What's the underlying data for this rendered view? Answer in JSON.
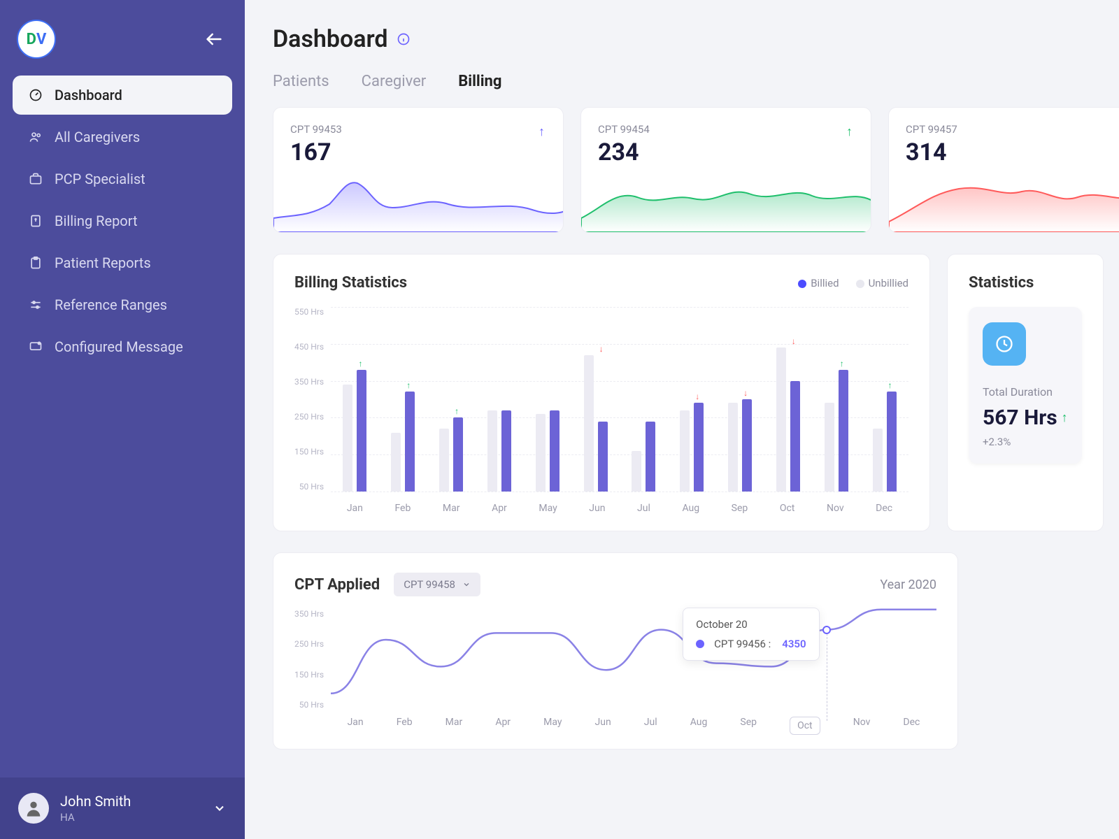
{
  "logo": {
    "d": "D",
    "v": "V"
  },
  "sidebar": {
    "items": [
      {
        "label": "Dashboard",
        "icon": "gauge-icon",
        "active": true
      },
      {
        "label": "All Caregivers",
        "icon": "people-icon"
      },
      {
        "label": "PCP Specialist",
        "icon": "briefcase-icon"
      },
      {
        "label": "Billing Report",
        "icon": "invoice-icon"
      },
      {
        "label": "Patient Reports",
        "icon": "clipboard-icon"
      },
      {
        "label": "Reference Ranges",
        "icon": "slider-icon"
      },
      {
        "label": "Configured Message",
        "icon": "message-icon"
      }
    ]
  },
  "user": {
    "name": "John Smith",
    "role": "HA"
  },
  "page": {
    "title": "Dashboard"
  },
  "tabs": [
    {
      "label": "Patients"
    },
    {
      "label": "Caregiver"
    },
    {
      "label": "Billing",
      "active": true
    }
  ],
  "cards": [
    {
      "label": "CPT 99453",
      "value": "167",
      "trend": "up",
      "color": "purple",
      "sparkColor": "#6c63ff"
    },
    {
      "label": "CPT 99454",
      "value": "234",
      "trend": "up",
      "color": "green",
      "sparkColor": "#1fbf6c"
    },
    {
      "label": "CPT 99457",
      "value": "314",
      "trend": "",
      "color": "",
      "sparkColor": "#ff5a5a"
    }
  ],
  "billing": {
    "title": "Billing Statistics",
    "legend": {
      "billed": "Billied",
      "unbilled": "Unbillied"
    },
    "yTicks": [
      "550 Hrs",
      "450 Hrs",
      "350 Hrs",
      "250 Hrs",
      "150 Hrs",
      "50 Hrs"
    ]
  },
  "stats": {
    "title": "Statistics",
    "duration": {
      "label": "Total Duration",
      "value": "567 Hrs",
      "delta": "+2.3%"
    }
  },
  "cpt": {
    "title": "CPT Applied",
    "dropdown": "CPT 99458",
    "year": "Year 2020",
    "yTicks": [
      "350 Hrs",
      "250 Hrs",
      "150 Hrs",
      "50 Hrs"
    ],
    "months": [
      "Jan",
      "Feb",
      "Mar",
      "Apr",
      "May",
      "Jun",
      "Jul",
      "Aug",
      "Sep",
      "Oct",
      "Nov",
      "Dec"
    ],
    "highlight": "Oct",
    "tooltip": {
      "title": "October 20",
      "label": "CPT 99456 :",
      "value": "4350"
    }
  },
  "chart_data": [
    {
      "type": "bar",
      "title": "Billing Statistics",
      "ylabel": "Hrs",
      "ylim": [
        50,
        550
      ],
      "categories": [
        "Jan",
        "Feb",
        "Mar",
        "Apr",
        "May",
        "Jun",
        "Jul",
        "Aug",
        "Sep",
        "Oct",
        "Nov",
        "Dec"
      ],
      "series": [
        {
          "name": "Unbillied",
          "values": [
            340,
            210,
            220,
            270,
            260,
            420,
            160,
            270,
            290,
            440,
            290,
            220
          ]
        },
        {
          "name": "Billied",
          "values": [
            380,
            320,
            250,
            270,
            270,
            240,
            240,
            290,
            300,
            350,
            380,
            320
          ]
        }
      ],
      "arrows": [
        "up",
        "up",
        "up",
        "",
        "",
        "down",
        "",
        "down",
        "down",
        "down",
        "up",
        "up"
      ]
    },
    {
      "type": "line",
      "title": "CPT Applied",
      "ylabel": "Hrs",
      "ylim": [
        50,
        350
      ],
      "categories": [
        "Jan",
        "Feb",
        "Mar",
        "Apr",
        "May",
        "Jun",
        "Jul",
        "Aug",
        "Sep",
        "Oct",
        "Nov",
        "Dec"
      ],
      "series": [
        {
          "name": "CPT 99458",
          "values": [
            90,
            250,
            170,
            270,
            270,
            160,
            280,
            180,
            170,
            280,
            340,
            340
          ]
        }
      ],
      "highlight_index": 9,
      "tooltip_value": 4350
    }
  ]
}
